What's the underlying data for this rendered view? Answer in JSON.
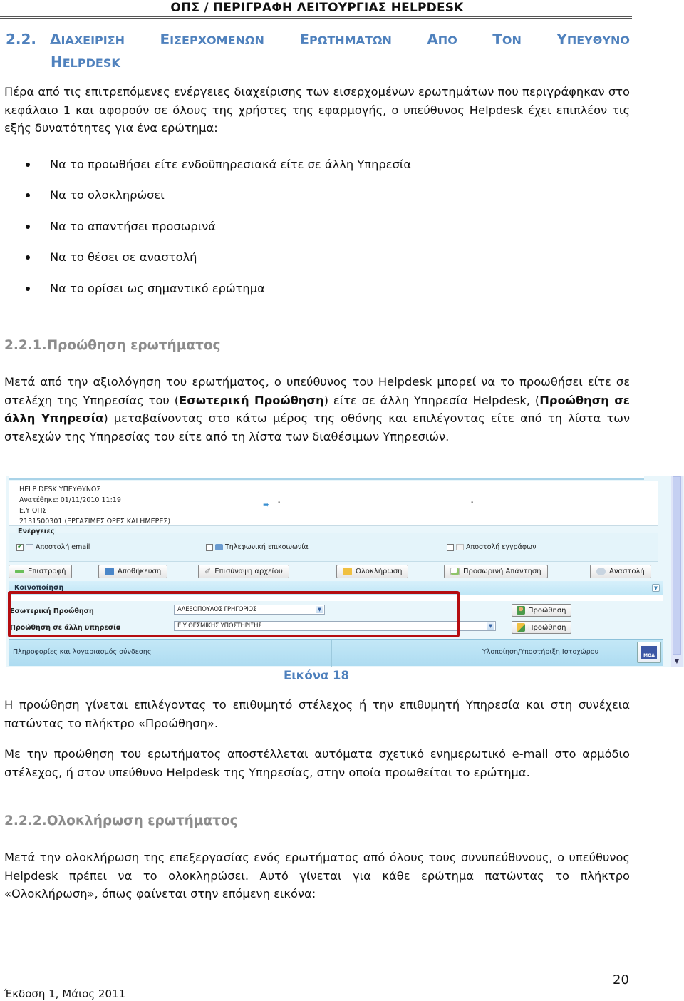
{
  "header": {
    "running_title": "ΟΠΣ / ΠΕΡΙΓΡΑΦΗ ΛΕΙΤΟΥΡΓΙΑΣ HELPDESK"
  },
  "section": {
    "number": "2.2.",
    "title_words": [
      "ΔΙΑΧΕΙΡΙΣΗ",
      "ΕΙΣΕΡΧΟΜΕΝΩΝ",
      "ΕΡΩΤΗΜΑΤΩΝ",
      "ΑΠΟ",
      "ΤΟΝ",
      "ΥΠΕΥΘΥΝΟ"
    ],
    "title_line2": "HELPDESK",
    "intro": "Πέρα από τις επιτρεπόμενες ενέργειες διαχείρισης των εισερχομένων ερωτημάτων που περιγράφηκαν στο κεφάλαιο 1 και αφορούν σε όλους της χρήστες της εφαρμογής, ο υπεύθυνος Helpdesk έχει επιπλέον τις εξής δυνατότητες για ένα ερώτημα:",
    "bullets": [
      "Να το προωθήσει είτε ενδοϋπηρεσιακά είτε σε άλλη Υπηρεσία",
      "Να το ολοκληρώσει",
      "Να το απαντήσει προσωρινά",
      "Να το θέσει σε αναστολή",
      "Να το ορίσει ως σημαντικό ερώτημα"
    ]
  },
  "sub1": {
    "heading": "2.2.1.Προώθηση ερωτήματος",
    "para_part1": "Μετά από την αξιολόγηση του ερωτήματος, ο υπεύθυνος του Helpdesk μπορεί να το προωθήσει είτε σε στελέχη της Υπηρεσίας του (",
    "bold1": "Εσωτερική Προώθηση",
    "para_part2": ") είτε σε άλλη Υπηρεσία Helpdesk, (",
    "bold2": "Προώθηση σε άλλη Υπηρεσία",
    "para_part3": ") μεταβαίνοντας στο κάτω μέρος της οθόνης και επιλέγοντας είτε από τη λίστα των στελεχών της Υπηρεσίας του είτε από τη λίστα των διαθέσιμων Υπηρεσιών.",
    "caption": "Εικόνα 18",
    "after1": "Η προώθηση γίνεται επιλέγοντας το επιθυμητό στέλεχος ή την επιθυμητή Υπηρεσία και στη συνέχεια πατώντας το πλήκτρο «Προώθηση».",
    "after2": "Με την προώθηση του ερωτήματος αποστέλλεται αυτόματα σχετικό ενημερωτικό e-mail στο αρμόδιο στέλεχος, ή στον υπεύθυνο Helpdesk της Υπηρεσίας, στην οποία προωθείται το ερώτημα."
  },
  "sub2": {
    "heading": "2.2.2.Ολοκλήρωση ερωτήματος",
    "para": "Μετά την ολοκλήρωση της επεξεργασίας ενός ερωτήματος από όλους τους συνυπεύθυνους, ο υπεύθυνος Helpdesk πρέπει να το ολοκληρώσει. Αυτό γίνεται για κάθε ερώτημα πατώντας το πλήκτρο «Ολοκλήρωση», όπως φαίνεται στην επόμενη εικόνα:"
  },
  "screenshot": {
    "info_lines": [
      "HELP DESK ΥΠΕΥΘΥΝΟΣ",
      "Ανατέθηκε: 01/11/2010 11:19",
      "Ε.Υ ΟΠΣ",
      "2131500301 (ΕΡΓΑΣΙΜΕΣ ΩΡΕΣ ΚΑΙ ΗΜΕΡΕΣ)"
    ],
    "dash": "-",
    "actions_legend": "Ενέργειες",
    "checkboxes": [
      {
        "label": "Αποστολή email",
        "checked": true,
        "icon": "envelope-icon"
      },
      {
        "label": "Τηλεφωνική επικοινωνία",
        "checked": false,
        "icon": "phone-icon"
      },
      {
        "label": "Αποστολή εγγράφων",
        "checked": false,
        "icon": "documents-icon"
      }
    ],
    "buttons": [
      {
        "label": "Επιστροφή",
        "icon": "back-arrow-icon",
        "color": "#6bbf59"
      },
      {
        "label": "Αποθήκευση",
        "icon": "save-icon",
        "color": "#4a86c8"
      },
      {
        "label": "Επισύναψη αρχείου",
        "icon": "paperclip-icon",
        "color": "#9a9a9a"
      },
      {
        "label": "Ολοκλήρωση",
        "icon": "folder-icon",
        "color": "#f0c040"
      },
      {
        "label": "Προσωρινή Απάντηση",
        "icon": "document-add-icon",
        "color": "#8fc36a"
      },
      {
        "label": "Αναστολή",
        "icon": "lightbulb-icon",
        "color": "#a8b8c8"
      }
    ],
    "notify_label": "Κοινοποίηση",
    "internal_forward": {
      "label": "Εσωτερική Προώθηση",
      "selected": "ΑΛΕΞΟΠΟΥΛΟΣ ΓΡΗΓΟΡΙΟΣ",
      "button": "Προώθηση"
    },
    "external_forward": {
      "label": "Προώθηση σε άλλη υπηρεσία",
      "selected": "Ε.Υ ΘΕΣΜΙΚΗΣ ΥΠΟΣΤΗΡΙΞΗΣ",
      "button": "Προώθηση"
    },
    "footer_link": "Πληροφορίες και λογαριασμός σύνδεσης",
    "footer_impl": "Υλοποίηση/Υποστήριξη Ιστοχώρου",
    "logo_text": "ΜΟΔ",
    "highlight_color": "#b50d10"
  },
  "footer": {
    "edition": "Έκδοση 1, Μάιος 2011",
    "page_number": "20"
  },
  "colors": {
    "heading_blue": "#4f81bd",
    "subheading_gray": "#8c8c8c"
  }
}
